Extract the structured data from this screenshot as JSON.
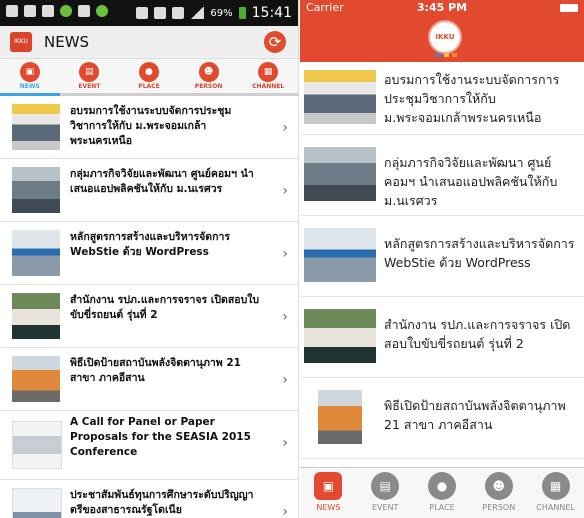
{
  "android": {
    "status": {
      "battery": "69%",
      "time": "15:41"
    },
    "app_title": "NEWS",
    "tabs": [
      {
        "label": "NEWS"
      },
      {
        "label": "EVENT"
      },
      {
        "label": "PLACE"
      },
      {
        "label": "PERSON"
      },
      {
        "label": "CHANNEL"
      }
    ],
    "items": [
      "อบรมการใช้งานระบบจัดการประชุมวิชาการให้กับ ม.พระจอมเกล้าพระนครเหนือ",
      "กลุ่มภารกิจวิจัยและพัฒนา ศูนย์คอมฯ นำเสนอแอปพลิคชันให้กับ ม.นเรศวร",
      "หลักสูตรการสร้างและบริหารจัดการ WebStie ด้วย WordPress",
      "สำนักงาน รปภ.และการจราจร เปิดสอบใบขับขี่รถยนต์ รุ่นที่ 2",
      "พิธีเปิดป้ายสถาบันพลังจิตตานุภาพ 21 สาขา ภาคอีสาน",
      "A Call for Panel or Paper Proposals for the SEASIA 2015 Conference",
      "ประชาสัมพันธ์ทุนการศึกษาระดับปริญญาตรีของสาธารณรัฐโดเนีย"
    ]
  },
  "ios": {
    "status": {
      "carrier": "Carrier",
      "time": "3:45 PM"
    },
    "items": [
      "อบรมการใช้งานระบบจัดการการประชุมวิชาการให้กับ ม.พระจอมเกล้าพระนครเหนือ",
      "กลุ่มภารกิจวิจัยและพัฒนา ศูนย์คอมฯ นำเสนอแอปพลิคชันให้กับ ม.นเรศวร",
      "หลักสูตรการสร้างและบริหารจัดการ WebStie ด้วย WordPress",
      "สำนักงาน รปภ.และการจราจร เปิดสอบใบขับขี่รถยนต์ รุ่นที่ 2",
      "พิธีเปิดป้ายสถาบันพลังจิตตานุภาพ 21 สาขา ภาคอีสาน"
    ],
    "tabs": [
      {
        "label": "NEWS"
      },
      {
        "label": "EVENT"
      },
      {
        "label": "PLACE"
      },
      {
        "label": "PERSON"
      },
      {
        "label": "CHANNEL"
      }
    ]
  },
  "logo_text": "IKKU",
  "colors": {
    "brand": "#e24a2f",
    "active_tab": "#3aa6e8"
  },
  "icons": [
    "news-icon",
    "event-icon",
    "place-icon",
    "person-icon",
    "channel-icon",
    "refresh-icon",
    "chevron-right-icon"
  ]
}
